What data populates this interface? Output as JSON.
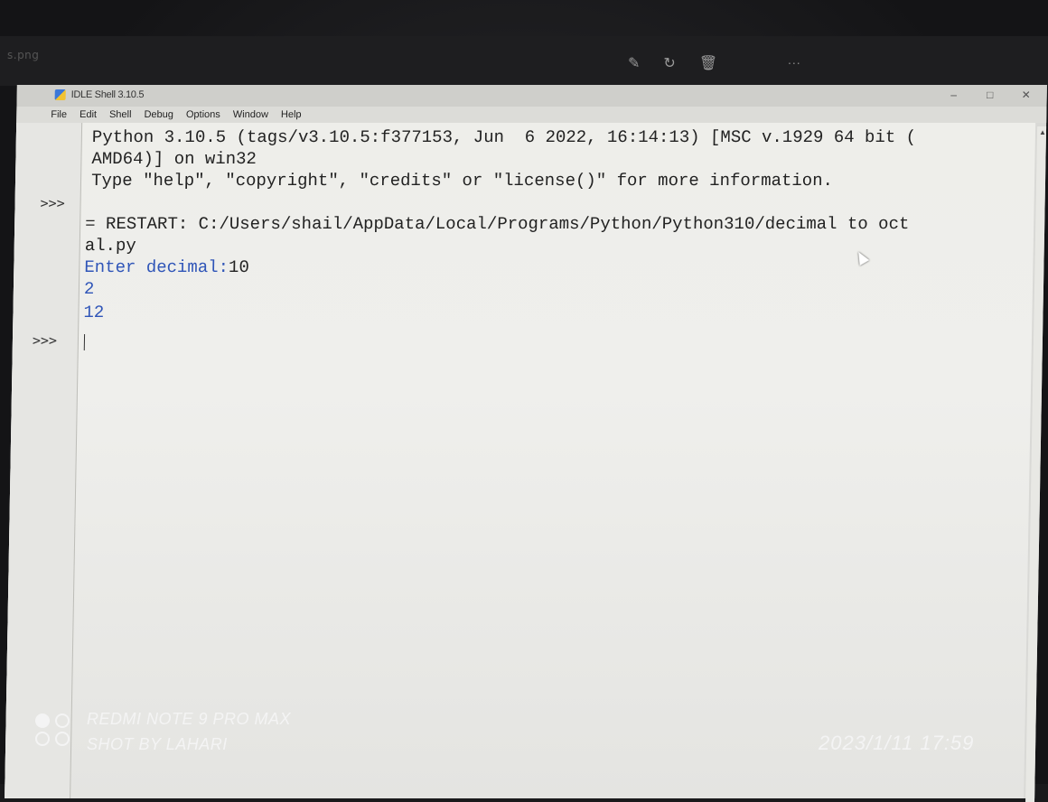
{
  "viewer": {
    "filename": "s.png",
    "icons": [
      "edit-icon",
      "rotate-icon",
      "delete-icon"
    ],
    "more_label": "..."
  },
  "window": {
    "title": "IDLE Shell 3.10.5",
    "controls": {
      "minimize": "–",
      "maximize": "□",
      "close": "✕"
    }
  },
  "menubar": {
    "items": [
      "File",
      "Edit",
      "Shell",
      "Debug",
      "Options",
      "Window",
      "Help"
    ]
  },
  "shell": {
    "prompts": [
      ">>>",
      ">>>"
    ],
    "lines": [
      "Python 3.10.5 (tags/v3.10.5:f377153, Jun  6 2022, 16:14:13) [MSC v.1929 64 bit (",
      "AMD64)] on win32",
      "Type \"help\", \"copyright\", \"credits\" or \"license()\" for more information.",
      "= RESTART: C:/Users/shail/AppData/Local/Programs/Python/Python310/decimal to oct",
      "al.py"
    ],
    "input_prompt": "Enter decimal:",
    "input_value": "10",
    "outputs": [
      "2",
      "12"
    ]
  },
  "watermark": {
    "device": "REDMI NOTE 9 PRO MAX",
    "credit": "SHOT BY LAHARI",
    "timestamp": "2023/1/11  17:59"
  }
}
